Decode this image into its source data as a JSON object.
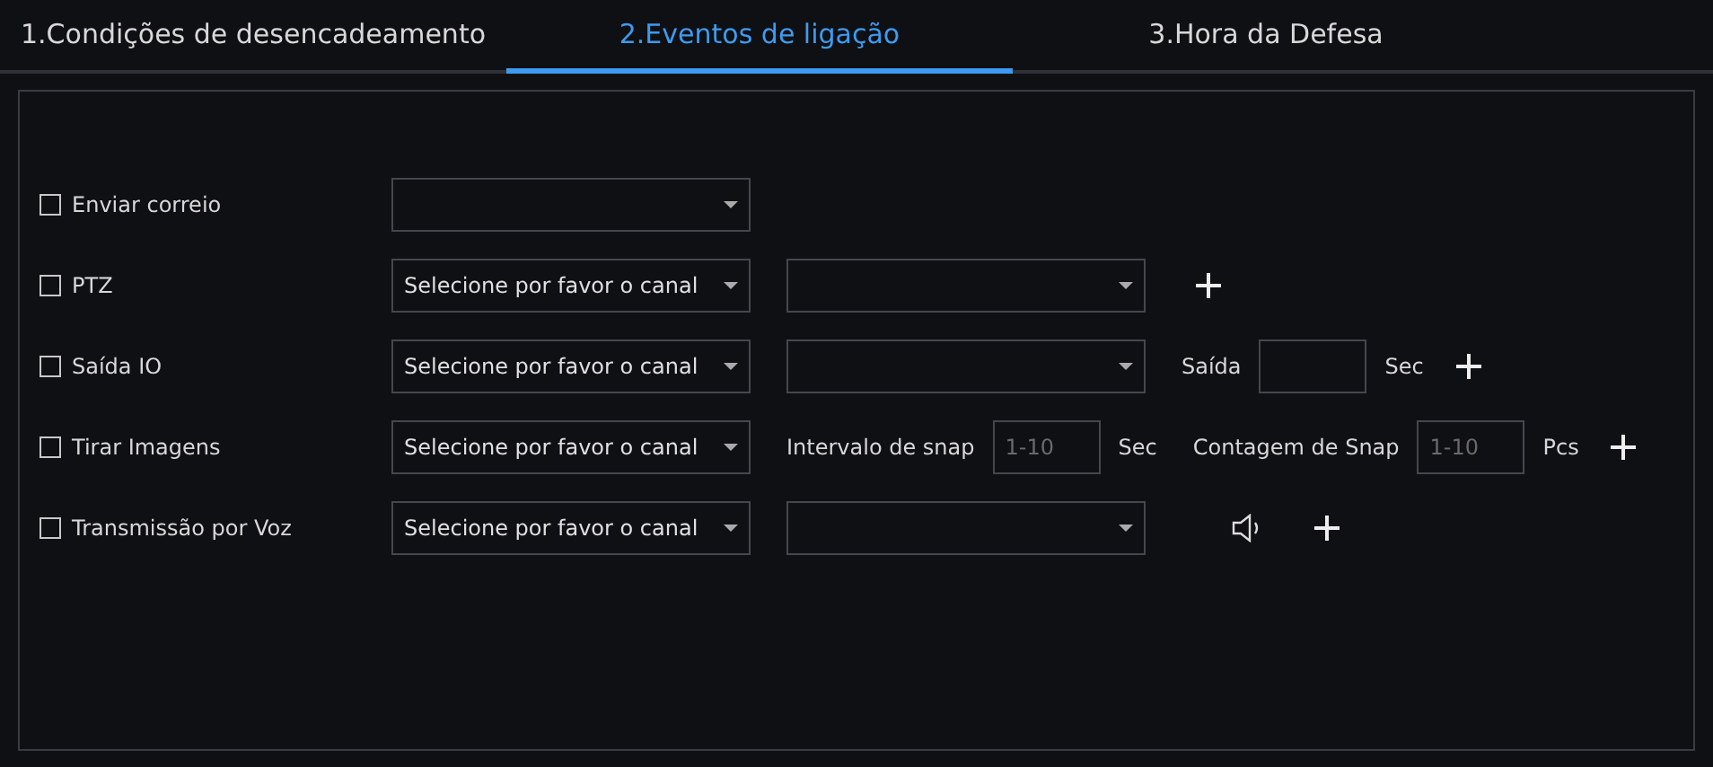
{
  "tabs": [
    {
      "label": "1.Condições de desencadeamento",
      "selected": false
    },
    {
      "label": "2.Eventos de ligação",
      "selected": true
    },
    {
      "label": "3.Hora da Defesa",
      "selected": false
    }
  ],
  "rows": [
    {
      "label": "Enviar correio",
      "checked": false,
      "controls": [
        {
          "kind": "select"
        }
      ]
    },
    {
      "label": "PTZ",
      "checked": false,
      "controls": [
        {
          "kind": "select",
          "value": "Selecione por favor o canal"
        },
        {
          "kind": "select"
        },
        {
          "kind": "plus"
        }
      ]
    },
    {
      "label": "Saída IO",
      "checked": false,
      "controls": [
        {
          "kind": "select",
          "value": "Selecione por favor o canal"
        },
        {
          "kind": "select"
        },
        {
          "kind": "text",
          "text": "Saída"
        },
        {
          "kind": "input"
        },
        {
          "kind": "text",
          "text": "Sec"
        },
        {
          "kind": "plus"
        }
      ]
    },
    {
      "label": "Tirar Imagens",
      "checked": false,
      "controls": [
        {
          "kind": "select",
          "value": "Selecione por favor o canal"
        },
        {
          "kind": "text",
          "text": "Intervalo de snap"
        },
        {
          "kind": "input",
          "placeholder": "1-10"
        },
        {
          "kind": "text",
          "text": "Sec"
        },
        {
          "kind": "text",
          "text": "Contagem de Snap"
        },
        {
          "kind": "input",
          "placeholder": "1-10"
        },
        {
          "kind": "text",
          "text": "Pcs"
        },
        {
          "kind": "plus"
        }
      ]
    },
    {
      "label": "Transmissão por Voz",
      "checked": false,
      "controls": [
        {
          "kind": "select",
          "value": "Selecione por favor o canal"
        },
        {
          "kind": "select"
        },
        {
          "kind": "speaker"
        },
        {
          "kind": "plus"
        }
      ]
    }
  ]
}
